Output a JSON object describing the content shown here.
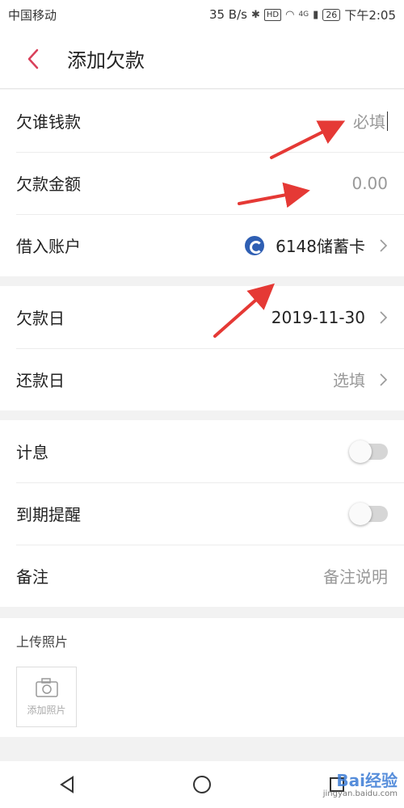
{
  "status_bar": {
    "carrier": "中国移动",
    "speed": "35 B/s",
    "hd": "HD",
    "network": "4G",
    "battery": "26",
    "time": "下午2:05"
  },
  "header": {
    "title": "添加欠款"
  },
  "form": {
    "creditor": {
      "label": "欠谁钱款",
      "placeholder": "必填"
    },
    "amount": {
      "label": "欠款金额",
      "placeholder": "0.00"
    },
    "account": {
      "label": "借入账户",
      "value": "6148储蓄卡"
    },
    "debt_date": {
      "label": "欠款日",
      "value": "2019-11-30"
    },
    "repay_date": {
      "label": "还款日",
      "value": "选填"
    },
    "interest": {
      "label": "计息",
      "enabled": false
    },
    "reminder": {
      "label": "到期提醒",
      "enabled": false
    },
    "note": {
      "label": "备注",
      "placeholder": "备注说明"
    }
  },
  "photo": {
    "section_label": "上传照片",
    "add_label": "添加照片"
  },
  "watermark": {
    "brand": "Bai经验",
    "url": "jingyan.baidu.com"
  },
  "colors": {
    "accent": "#d9405a",
    "annotation_arrow": "#e53935"
  }
}
